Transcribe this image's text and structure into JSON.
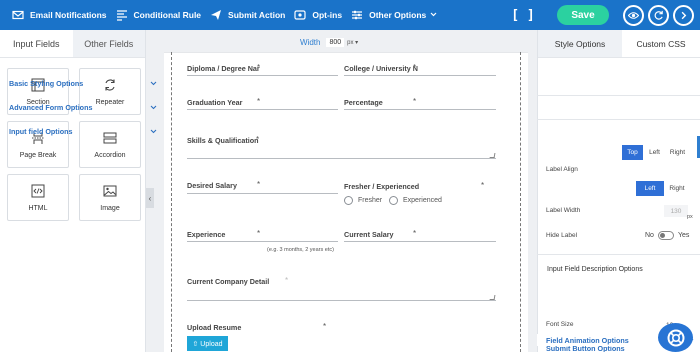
{
  "toolbar": {
    "items": [
      {
        "label": "Email Notifications",
        "icon": "envelope-icon"
      },
      {
        "label": "Conditional Rule",
        "icon": "code-icon"
      },
      {
        "label": "Submit Action",
        "icon": "send-icon"
      },
      {
        "label": "Opt-ins",
        "icon": "optin-icon"
      },
      {
        "label": "Other Options",
        "icon": "sliders-icon"
      }
    ],
    "bracket_label": "[ ]",
    "save_label": "Save"
  },
  "left_panel": {
    "tabs": [
      "Input Fields",
      "Other Fields"
    ],
    "active_tab": "Other Fields",
    "cards": [
      {
        "label": "Section",
        "icon": "section-icon"
      },
      {
        "label": "Repeater",
        "icon": "repeater-icon"
      },
      {
        "label": "Page Break",
        "icon": "page-break-icon"
      },
      {
        "label": "Accordion",
        "icon": "accordion-icon"
      },
      {
        "label": "HTML",
        "icon": "html-icon"
      },
      {
        "label": "Image",
        "icon": "image-icon"
      }
    ]
  },
  "canvas": {
    "width_label": "Width",
    "width_value": "800",
    "width_unit": "px ▾",
    "fields": {
      "diploma": "Diploma / Degree Nar",
      "college": "College / University N",
      "graduation_year": "Graduation Year",
      "percentage": "Percentage",
      "skills": "Skills & Qualification",
      "desired_salary": "Desired Salary",
      "fresher_experienced": "Fresher / Experienced",
      "radio_fresher": "Fresher",
      "radio_experienced": "Experienced",
      "experience": "Experience",
      "experience_hint": "(e.g. 3 months, 2 years etc)",
      "current_salary": "Current Salary",
      "current_company": "Current Company Detail",
      "upload_resume": "Upload Resume",
      "upload_button": "⇧ Upload"
    },
    "required_mark": "*"
  },
  "right_panel": {
    "tabs": [
      "Style Options",
      "Custom CSS"
    ],
    "active_tab": "Style Options",
    "sections": {
      "basic_styling": "Basic Styling Options",
      "advanced_form": "Advanced Form Options",
      "input_field": "Input field Options",
      "field_animation": "Field Animation Options",
      "submit_button": "Submit Button Options"
    },
    "label_align": {
      "label": "Label Align",
      "position_options": [
        "Top",
        "Left",
        "Right"
      ],
      "position_selected": "Top",
      "align_options": [
        "Left",
        "Right"
      ],
      "align_selected": "Left"
    },
    "label_width": {
      "label": "Label Width",
      "value": "130",
      "unit": "px"
    },
    "hide_label": {
      "label": "Hide Label",
      "off": "No",
      "on": "Yes",
      "value": "No"
    },
    "description_heading": "Input Field Description Options",
    "font_size": {
      "label": "Font Size",
      "value": "12 ▾"
    }
  },
  "colors": {
    "toolbar_bg": "#1a73c9",
    "save_bg": "#2bd1a0",
    "accent": "#2b6fc0",
    "segment_on": "#2f6fd6",
    "upload_bg": "#1fa6d8"
  }
}
